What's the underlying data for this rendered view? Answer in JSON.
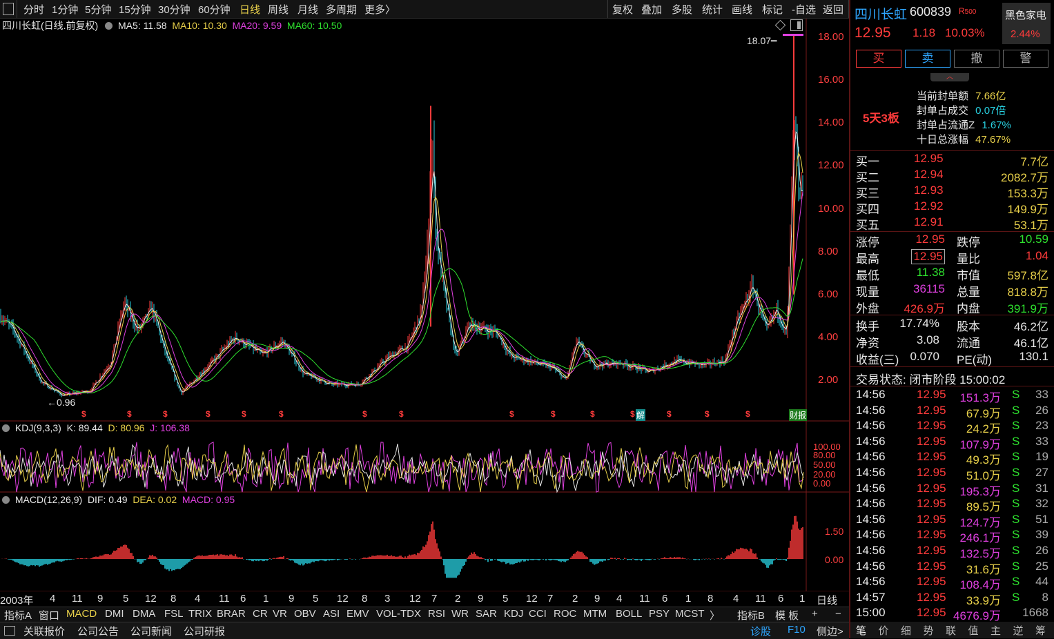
{
  "toolbar": {
    "periods": [
      "分时",
      "1分钟",
      "5分钟",
      "15分钟",
      "30分钟",
      "60分钟",
      "日线",
      "周线",
      "月线",
      "多周期",
      "更多〉"
    ],
    "active_period": "日线",
    "tools": [
      "复权",
      "叠加",
      "多股",
      "统计",
      "画线",
      "标记",
      "-自选",
      "返回"
    ]
  },
  "main_legend": {
    "title": "四川长虹(日线.前复权)",
    "ma5": "MA5: 11.58",
    "ma10": "MA10: 10.30",
    "ma20": "MA20: 9.59",
    "ma60": "MA60: 10.50"
  },
  "price_axis": [
    "18.00",
    "16.00",
    "14.00",
    "12.00",
    "10.00",
    "8.00",
    "6.00",
    "4.00",
    "2.00"
  ],
  "annotations": {
    "high": "18.07",
    "low": "0.96"
  },
  "event_markers": {
    "dividend": "$",
    "unlock": "解",
    "report": "财报"
  },
  "kdj_legend": {
    "name": "KDJ(9,3,3)",
    "k": "K: 89.44",
    "d": "D: 80.96",
    "j": "J: 106.38"
  },
  "kdj_axis": [
    "100.00",
    "80.00",
    "50.00",
    "20.00",
    "0.00"
  ],
  "macd_legend": {
    "name": "MACD(12,26,9)",
    "dif": "DIF: 0.49",
    "dea": "DEA: 0.02",
    "macd": "MACD: 0.95"
  },
  "macd_axis": [
    "1.50",
    "0.00"
  ],
  "x_axis": [
    "2003年",
    "4",
    "11",
    "9",
    "5",
    "12",
    "8",
    "4",
    "11",
    "6",
    "1",
    "9",
    "5",
    "12",
    "8",
    "3",
    "12",
    "7",
    "2",
    "9",
    "5",
    "12",
    "7",
    "2",
    "9",
    "4",
    "11",
    "6",
    "1",
    "8",
    "4",
    "11",
    "6",
    "1"
  ],
  "x_axis_right": "日线",
  "indicator_tabs": [
    "指标A",
    "窗口",
    "MACD",
    "DMI",
    "DMA",
    "FSL",
    "TRIX",
    "BRAR",
    "CR",
    "VR",
    "OBV",
    "ASI",
    "EMV",
    "VOL-TDX",
    "RSI",
    "WR",
    "SAR",
    "KDJ",
    "CCI",
    "ROC",
    "MTM",
    "BOLL",
    "PSY",
    "MCST",
    "〉"
  ],
  "indicator_right": [
    "指标B",
    "模 板",
    "+",
    "−"
  ],
  "status_tabs": [
    "关联报价",
    "公司公告",
    "公司新闻",
    "公司研报"
  ],
  "status_right": [
    "诊股",
    "F10",
    "侧边>"
  ],
  "quote": {
    "name": "四川长虹",
    "code": "600839",
    "badge": "R",
    "badge_sub": "500",
    "price": "12.95",
    "change": "1.18",
    "pct": "10.03%",
    "sector": "黑色家电",
    "sector_pct": "2.44%"
  },
  "trade_buttons": [
    "买",
    "卖",
    "撤",
    "警"
  ],
  "limit_info": {
    "tag": "5天3板",
    "rows": [
      {
        "label": "当前封单额",
        "value": "7.66亿"
      },
      {
        "label": "封单占成交",
        "value": "0.07倍"
      },
      {
        "label": "封单占流通Z",
        "value": "1.67%"
      },
      {
        "label": "十日总涨幅",
        "value": "47.67%"
      }
    ]
  },
  "bids": [
    {
      "label": "买一",
      "price": "12.95",
      "vol": "7.7亿"
    },
    {
      "label": "买二",
      "price": "12.94",
      "vol": "2082.7万"
    },
    {
      "label": "买三",
      "price": "12.93",
      "vol": "153.3万"
    },
    {
      "label": "买四",
      "price": "12.92",
      "vol": "149.9万"
    },
    {
      "label": "买五",
      "price": "12.91",
      "vol": "53.1万"
    }
  ],
  "stats": [
    {
      "l1": "涨停",
      "v1": "12.95",
      "l2": "跌停",
      "v2": "10.59"
    },
    {
      "l1": "最高",
      "v1": "12.95",
      "l2": "量比",
      "v2": "1.04"
    },
    {
      "l1": "最低",
      "v1": "11.38",
      "l2": "市值",
      "v2": "597.8亿"
    },
    {
      "l1": "现量",
      "v1": "36115",
      "l2": "总量",
      "v2": "818.8万"
    },
    {
      "l1": "外盘",
      "v1": "426.9万",
      "l2": "内盘",
      "v2": "391.9万"
    }
  ],
  "fundamentals": [
    {
      "l1": "换手",
      "v1": "17.74%",
      "l2": "股本",
      "v2": "46.2亿"
    },
    {
      "l1": "净资",
      "v1": "3.08",
      "l2": "流通",
      "v2": "46.1亿"
    },
    {
      "l1": "收益(三)",
      "v1": "0.070",
      "l2": "PE(动)",
      "v2": "130.1"
    }
  ],
  "trade_state": "交易状态: 闭市阶段 15:00:02",
  "ticks": [
    {
      "t": "14:56",
      "p": "12.95",
      "v": "151.3万",
      "s": "S",
      "n": "33"
    },
    {
      "t": "14:56",
      "p": "12.95",
      "v": "67.9万",
      "s": "S",
      "n": "26"
    },
    {
      "t": "14:56",
      "p": "12.95",
      "v": "24.2万",
      "s": "S",
      "n": "23"
    },
    {
      "t": "14:56",
      "p": "12.95",
      "v": "107.9万",
      "s": "S",
      "n": "33"
    },
    {
      "t": "14:56",
      "p": "12.95",
      "v": "49.3万",
      "s": "S",
      "n": "19"
    },
    {
      "t": "14:56",
      "p": "12.95",
      "v": "51.0万",
      "s": "S",
      "n": "27"
    },
    {
      "t": "14:56",
      "p": "12.95",
      "v": "195.3万",
      "s": "S",
      "n": "31"
    },
    {
      "t": "14:56",
      "p": "12.95",
      "v": "89.5万",
      "s": "S",
      "n": "32"
    },
    {
      "t": "14:56",
      "p": "12.95",
      "v": "124.7万",
      "s": "S",
      "n": "51"
    },
    {
      "t": "14:56",
      "p": "12.95",
      "v": "246.1万",
      "s": "S",
      "n": "39"
    },
    {
      "t": "14:56",
      "p": "12.95",
      "v": "132.5万",
      "s": "S",
      "n": "26"
    },
    {
      "t": "14:56",
      "p": "12.95",
      "v": "31.6万",
      "s": "S",
      "n": "25"
    },
    {
      "t": "14:56",
      "p": "12.95",
      "v": "108.4万",
      "s": "S",
      "n": "44"
    },
    {
      "t": "14:57",
      "p": "12.95",
      "v": "33.9万",
      "s": "S",
      "n": "8"
    },
    {
      "t": "15:00",
      "p": "12.95",
      "v": "4676.9万",
      "s": "",
      "n": "1668"
    }
  ],
  "right_tabs": [
    "笔",
    "价",
    "细",
    "势",
    "联",
    "值",
    "主",
    "逆",
    "筹"
  ],
  "colors": {
    "up": "#ff3b3b",
    "down": "#2ee02e",
    "ma5": "#e6e6e6",
    "ma10": "#e8d04a",
    "ma20": "#e040e0",
    "ma60": "#2ee02e",
    "macd_neg": "#28d0e0"
  }
}
